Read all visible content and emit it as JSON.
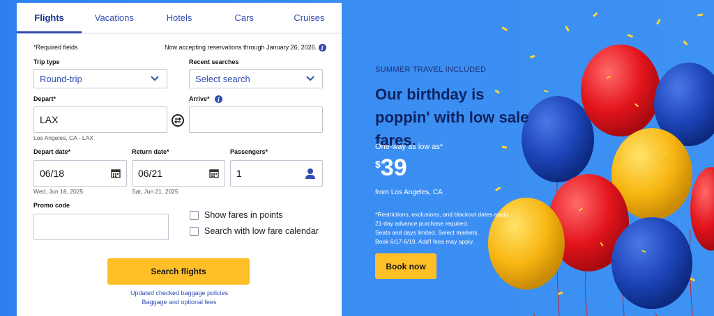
{
  "tabs": [
    "Flights",
    "Vacations",
    "Hotels",
    "Cars",
    "Cruises"
  ],
  "form": {
    "required_note": "*Required fields",
    "reservation_note": "Now accepting reservations through January 26, 2026.",
    "trip_type_label": "Trip type",
    "trip_type_value": "Round-trip",
    "recent_label": "Recent searches",
    "recent_value": "Select search",
    "depart_label": "Depart*",
    "depart_value": "LAX",
    "depart_sub": "Los Angeles, CA - LAX",
    "arrive_label": "Arrive*",
    "arrive_value": "",
    "depart_date_label": "Depart date*",
    "depart_date_value": "06/18",
    "depart_date_sub": "Wed, Jun 18, 2025",
    "return_date_label": "Return date*",
    "return_date_value": "06/21",
    "return_date_sub": "Sat, Jun 21, 2025",
    "passengers_label": "Passengers*",
    "passengers_value": "1",
    "promo_label": "Promo code",
    "promo_value": "",
    "opt_points": "Show fares in points",
    "opt_calendar": "Search with low fare calendar",
    "search_button": "Search flights",
    "link_baggage": "Updated checked baggage policies",
    "link_fees": "Baggage and optional fees"
  },
  "promo": {
    "kicker": "SUMMER TRAVEL INCLUDED",
    "headline": "Our birthday is poppin' with low sale fares.",
    "as_low_as": "One-way as low as*",
    "currency": "$",
    "price": "39",
    "from": "from Los Angeles, CA",
    "fine_1": "*Restrictions, exclusions, and blackout dates apply.",
    "fine_2": "21-day advance purchase required.",
    "fine_3": "Seats and days limited. Select markets.",
    "fine_4": "Book 6/17-6/19. Add'l fees may apply.",
    "book_button": "Book now"
  },
  "colors": {
    "brand_blue": "#304cb2",
    "brand_yellow": "#ffbf27",
    "hero_blue": "#3a8df2",
    "headline_navy": "#0f2260"
  },
  "icons": [
    "chevron-down-icon",
    "info-icon",
    "swap-icon",
    "calendar-icon",
    "person-icon"
  ]
}
